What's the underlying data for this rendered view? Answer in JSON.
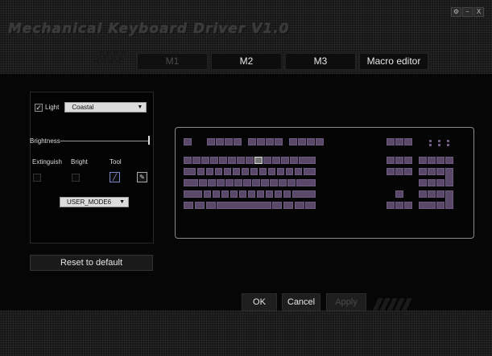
{
  "window": {
    "title": "Mechanical Keyboard Driver V1.0",
    "controls": [
      "⚙",
      "−",
      "X"
    ]
  },
  "tabs": [
    {
      "label": "M1",
      "disabled": true
    },
    {
      "label": "M2",
      "disabled": false
    },
    {
      "label": "M3",
      "disabled": false
    },
    {
      "label": "Macro editor",
      "disabled": false
    }
  ],
  "lighting": {
    "light_label": "Light",
    "light_checked": true,
    "effect": "Coastal",
    "brightness_label": "Brightness",
    "brightness_level": 1.0,
    "columns": [
      "Extinguish",
      "Bright",
      "Tool"
    ],
    "mode": "USER_MODE6"
  },
  "reset_label": "Reset to default",
  "actions": {
    "ok": "OK",
    "cancel": "Cancel",
    "apply": "Apply"
  },
  "icons": {
    "settings": "gear-icon",
    "minimize": "minimize-icon",
    "close": "close-icon",
    "pen": "pen-icon",
    "eyedropper": "eyedropper-icon",
    "dropdown": "chevron-down-icon"
  },
  "colors": {
    "key_fill": "#5a4868",
    "key_border": "#6e5a82",
    "accent": "#7a86c8"
  }
}
